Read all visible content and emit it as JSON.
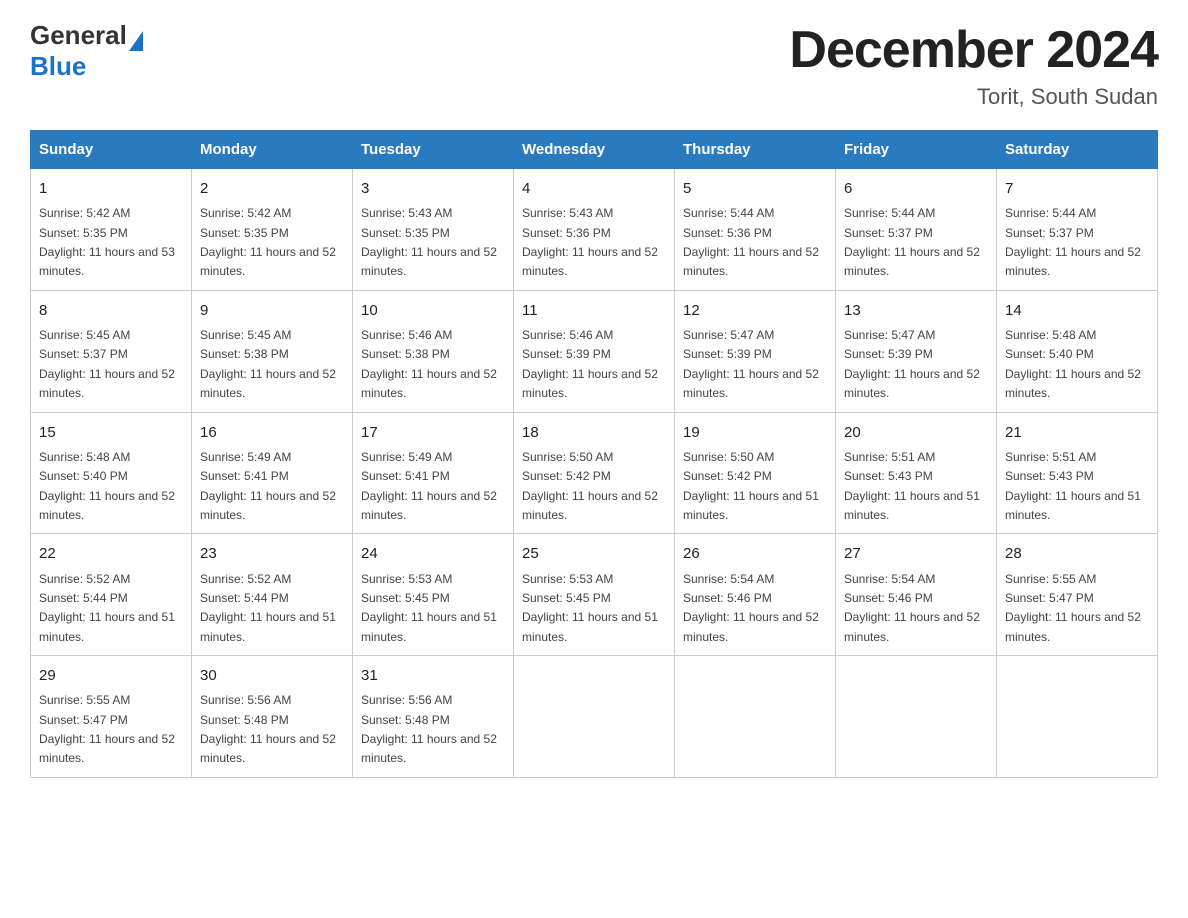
{
  "header": {
    "logo_general": "General",
    "logo_blue": "Blue",
    "month_title": "December 2024",
    "location": "Torit, South Sudan"
  },
  "weekdays": [
    "Sunday",
    "Monday",
    "Tuesday",
    "Wednesday",
    "Thursday",
    "Friday",
    "Saturday"
  ],
  "weeks": [
    [
      {
        "day": "1",
        "sunrise": "5:42 AM",
        "sunset": "5:35 PM",
        "daylight": "11 hours and 53 minutes."
      },
      {
        "day": "2",
        "sunrise": "5:42 AM",
        "sunset": "5:35 PM",
        "daylight": "11 hours and 52 minutes."
      },
      {
        "day": "3",
        "sunrise": "5:43 AM",
        "sunset": "5:35 PM",
        "daylight": "11 hours and 52 minutes."
      },
      {
        "day": "4",
        "sunrise": "5:43 AM",
        "sunset": "5:36 PM",
        "daylight": "11 hours and 52 minutes."
      },
      {
        "day": "5",
        "sunrise": "5:44 AM",
        "sunset": "5:36 PM",
        "daylight": "11 hours and 52 minutes."
      },
      {
        "day": "6",
        "sunrise": "5:44 AM",
        "sunset": "5:37 PM",
        "daylight": "11 hours and 52 minutes."
      },
      {
        "day": "7",
        "sunrise": "5:44 AM",
        "sunset": "5:37 PM",
        "daylight": "11 hours and 52 minutes."
      }
    ],
    [
      {
        "day": "8",
        "sunrise": "5:45 AM",
        "sunset": "5:37 PM",
        "daylight": "11 hours and 52 minutes."
      },
      {
        "day": "9",
        "sunrise": "5:45 AM",
        "sunset": "5:38 PM",
        "daylight": "11 hours and 52 minutes."
      },
      {
        "day": "10",
        "sunrise": "5:46 AM",
        "sunset": "5:38 PM",
        "daylight": "11 hours and 52 minutes."
      },
      {
        "day": "11",
        "sunrise": "5:46 AM",
        "sunset": "5:39 PM",
        "daylight": "11 hours and 52 minutes."
      },
      {
        "day": "12",
        "sunrise": "5:47 AM",
        "sunset": "5:39 PM",
        "daylight": "11 hours and 52 minutes."
      },
      {
        "day": "13",
        "sunrise": "5:47 AM",
        "sunset": "5:39 PM",
        "daylight": "11 hours and 52 minutes."
      },
      {
        "day": "14",
        "sunrise": "5:48 AM",
        "sunset": "5:40 PM",
        "daylight": "11 hours and 52 minutes."
      }
    ],
    [
      {
        "day": "15",
        "sunrise": "5:48 AM",
        "sunset": "5:40 PM",
        "daylight": "11 hours and 52 minutes."
      },
      {
        "day": "16",
        "sunrise": "5:49 AM",
        "sunset": "5:41 PM",
        "daylight": "11 hours and 52 minutes."
      },
      {
        "day": "17",
        "sunrise": "5:49 AM",
        "sunset": "5:41 PM",
        "daylight": "11 hours and 52 minutes."
      },
      {
        "day": "18",
        "sunrise": "5:50 AM",
        "sunset": "5:42 PM",
        "daylight": "11 hours and 52 minutes."
      },
      {
        "day": "19",
        "sunrise": "5:50 AM",
        "sunset": "5:42 PM",
        "daylight": "11 hours and 51 minutes."
      },
      {
        "day": "20",
        "sunrise": "5:51 AM",
        "sunset": "5:43 PM",
        "daylight": "11 hours and 51 minutes."
      },
      {
        "day": "21",
        "sunrise": "5:51 AM",
        "sunset": "5:43 PM",
        "daylight": "11 hours and 51 minutes."
      }
    ],
    [
      {
        "day": "22",
        "sunrise": "5:52 AM",
        "sunset": "5:44 PM",
        "daylight": "11 hours and 51 minutes."
      },
      {
        "day": "23",
        "sunrise": "5:52 AM",
        "sunset": "5:44 PM",
        "daylight": "11 hours and 51 minutes."
      },
      {
        "day": "24",
        "sunrise": "5:53 AM",
        "sunset": "5:45 PM",
        "daylight": "11 hours and 51 minutes."
      },
      {
        "day": "25",
        "sunrise": "5:53 AM",
        "sunset": "5:45 PM",
        "daylight": "11 hours and 51 minutes."
      },
      {
        "day": "26",
        "sunrise": "5:54 AM",
        "sunset": "5:46 PM",
        "daylight": "11 hours and 52 minutes."
      },
      {
        "day": "27",
        "sunrise": "5:54 AM",
        "sunset": "5:46 PM",
        "daylight": "11 hours and 52 minutes."
      },
      {
        "day": "28",
        "sunrise": "5:55 AM",
        "sunset": "5:47 PM",
        "daylight": "11 hours and 52 minutes."
      }
    ],
    [
      {
        "day": "29",
        "sunrise": "5:55 AM",
        "sunset": "5:47 PM",
        "daylight": "11 hours and 52 minutes."
      },
      {
        "day": "30",
        "sunrise": "5:56 AM",
        "sunset": "5:48 PM",
        "daylight": "11 hours and 52 minutes."
      },
      {
        "day": "31",
        "sunrise": "5:56 AM",
        "sunset": "5:48 PM",
        "daylight": "11 hours and 52 minutes."
      },
      null,
      null,
      null,
      null
    ]
  ]
}
